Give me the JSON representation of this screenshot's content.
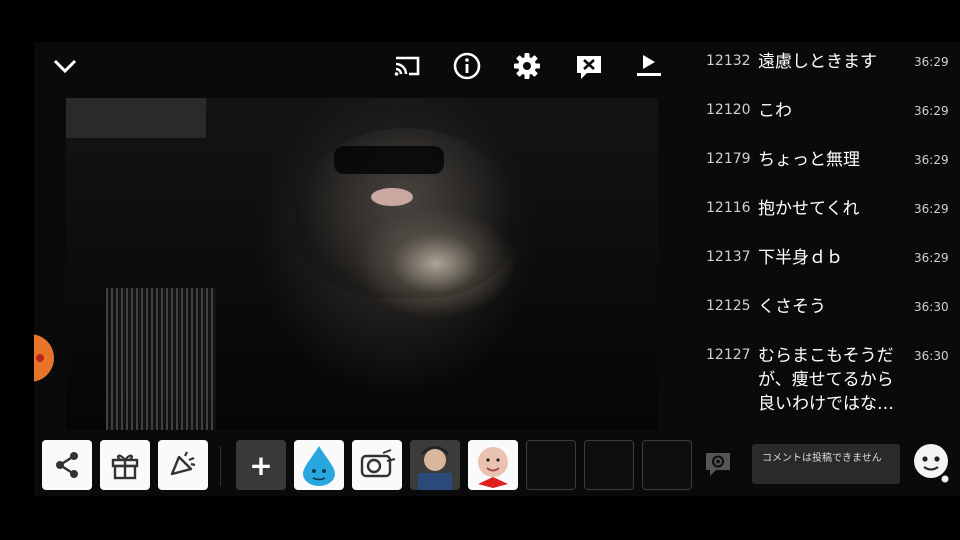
{
  "topbar": {
    "icons": [
      "chevron-down-icon",
      "cast-icon",
      "info-icon",
      "gear-icon",
      "comment-off-icon",
      "playlist-icon"
    ]
  },
  "toolbar": {
    "items": [
      "share-icon",
      "gift-icon",
      "megaphone-icon",
      "plus-icon",
      "sticker-drop",
      "sticker-camera",
      "sticker-avatar-1",
      "sticker-avatar-2",
      "empty-slot",
      "empty-slot",
      "empty-slot"
    ],
    "plus_label": "+"
  },
  "chat": {
    "messages": [
      {
        "id": "12132",
        "text": "遠慮しときます",
        "time": "36:29"
      },
      {
        "id": "12120",
        "text": "こわ",
        "time": "36:29"
      },
      {
        "id": "12179",
        "text": "ちょっと無理",
        "time": "36:29"
      },
      {
        "id": "12116",
        "text": "抱かせてくれ",
        "time": "36:29"
      },
      {
        "id": "12137",
        "text": "下半身ｄｂ",
        "time": "36:29"
      },
      {
        "id": "12125",
        "text": "くさそう",
        "time": "36:30"
      },
      {
        "id": "12127",
        "text": "むらまこもそうだが、痩せてるから良いわけではな…",
        "time": "36:30"
      }
    ]
  },
  "comment": {
    "placeholder": "コメントは投稿できません",
    "settings_icon": "comment-settings-icon",
    "avatar_icon": "smiley-avatar-icon"
  },
  "colors": {
    "background": "#000000",
    "panel": "#0a0a0a",
    "accent_orange": "#e8742a"
  }
}
